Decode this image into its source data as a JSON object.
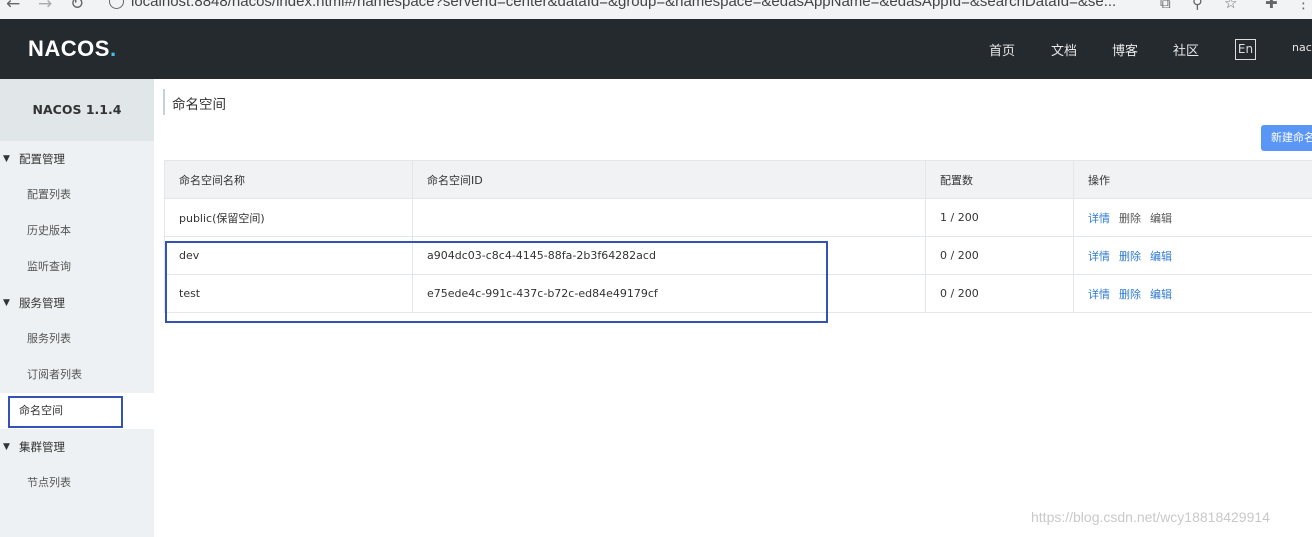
{
  "browser": {
    "url": "localhost:8848/nacos/index.html#/namespace?serverId=center&dataId=&group=&namespace=&edasAppName=&edasAppId=&searchDataId=&se..."
  },
  "header": {
    "logo": "NACOS",
    "logo_dot": ".",
    "nav": [
      "首页",
      "文档",
      "博客",
      "社区"
    ],
    "lang": "En",
    "user": "nacos"
  },
  "sidebar": {
    "version": "NACOS 1.1.4",
    "groups": [
      {
        "label": "配置管理",
        "items": [
          "配置列表",
          "历史版本",
          "监听查询"
        ]
      },
      {
        "label": "服务管理",
        "items": [
          "服务列表",
          "订阅者列表",
          "命名空间"
        ]
      },
      {
        "label": "集群管理",
        "items": [
          "节点列表"
        ]
      }
    ]
  },
  "main": {
    "title": "命名空间",
    "new_button": "新建命名空间",
    "table": {
      "headers": [
        "命名空间名称",
        "命名空间ID",
        "配置数",
        "操作"
      ],
      "rows": [
        {
          "name": "public(保留空间)",
          "id": "",
          "count": "1 / 200",
          "ops": [
            "详情",
            "删除",
            "编辑"
          ]
        },
        {
          "name": "dev",
          "id": "a904dc03-c8c4-4145-88fa-2b3f64282acd",
          "count": "0 / 200",
          "ops": [
            "详情",
            "删除",
            "编辑"
          ]
        },
        {
          "name": "test",
          "id": "e75ede4c-991c-437c-b72c-ed84e49179cf",
          "count": "0 / 200",
          "ops": [
            "详情",
            "删除",
            "编辑"
          ]
        }
      ]
    }
  },
  "watermark": "https://blog.csdn.net/wcy18818429914",
  "colors": {
    "header_bg": "#252a2f",
    "sidebar_bg": "#eef1f3",
    "primary": "#5a96f5",
    "link": "#2f7bd4",
    "annotation": "#3452b8"
  }
}
